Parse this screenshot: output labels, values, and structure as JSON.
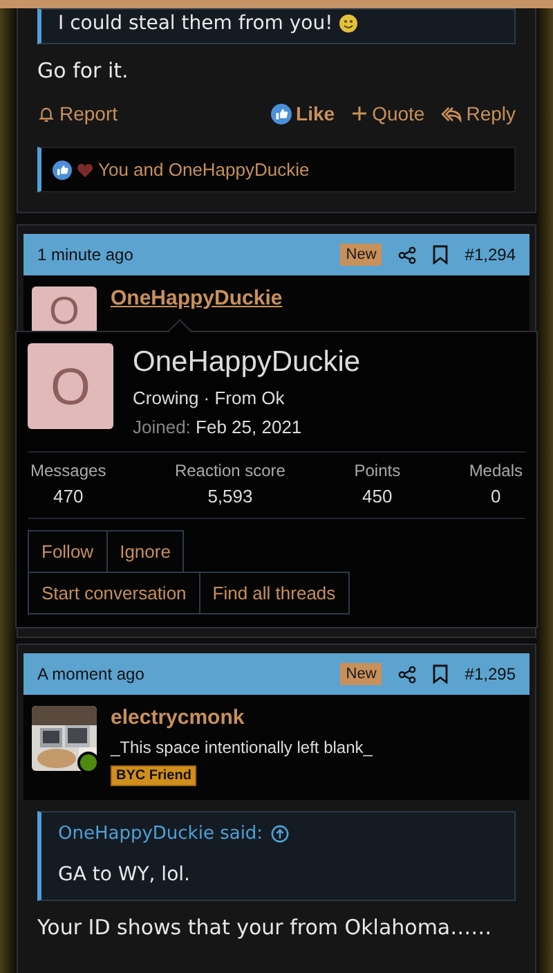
{
  "post_top": {
    "quote_text": "I could steal them from you!",
    "body": "Go for it.",
    "actions": [
      {
        "kind": "report",
        "label": "Report"
      },
      {
        "kind": "like",
        "label": "Like",
        "selected": true
      },
      {
        "kind": "quote",
        "label": "Quote"
      },
      {
        "kind": "reply",
        "label": "Reply"
      }
    ],
    "reactions": "You and OneHappyDuckie"
  },
  "post_second": {
    "time": "1 minute ago",
    "badge": "New",
    "number": "#1,294",
    "author": "OneHappyDuckie",
    "avatar_letter": "O"
  },
  "profile_popup": {
    "avatar_letter": "O",
    "name": "OneHappyDuckie",
    "subtitle": "Crowing · From Ok",
    "joined_label": "Joined:",
    "joined_date": "Feb 25, 2021",
    "stats": [
      {
        "label": "Messages",
        "value": "470"
      },
      {
        "label": "Reaction score",
        "value": "5,593"
      },
      {
        "label": "Points",
        "value": "450"
      },
      {
        "label": "Medals",
        "value": "0"
      }
    ],
    "button_rows": [
      [
        "Follow",
        "Ignore"
      ],
      [
        "Start conversation",
        "Find all threads"
      ]
    ]
  },
  "post_third": {
    "time": "A moment ago",
    "badge": "New",
    "number": "#1,295",
    "author": "electrycmonk",
    "avatar": {
      "online": true
    },
    "user_title": "_This space intentionally left blank_",
    "banner": "BYC Friend",
    "quote_author": "OneHappyDuckie said:",
    "quote_text": "GA to WY, lol.",
    "body": "Your ID shows that your from Oklahoma……"
  }
}
